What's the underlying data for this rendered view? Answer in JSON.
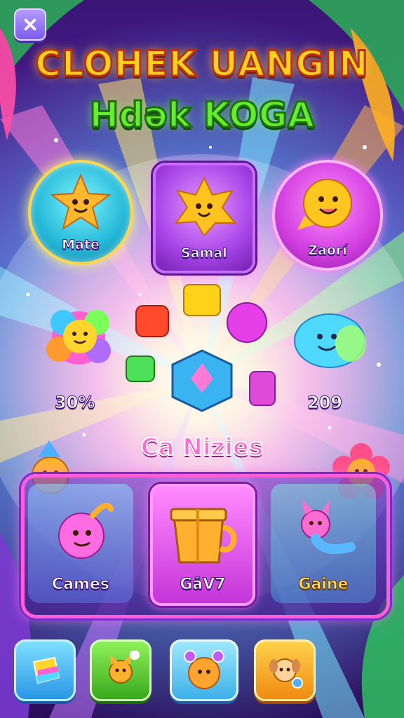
{
  "header": {
    "title_line1": "CLOHEK UANGIN",
    "title_line2": "Hdək KOGA"
  },
  "modes": [
    {
      "label": "Mate"
    },
    {
      "label": "Samal"
    },
    {
      "label": "Zaorí"
    }
  ],
  "stats": {
    "left_value": "30%",
    "right_value": "209"
  },
  "section_title": "Ca Nizies",
  "games": [
    {
      "label": "Cames"
    },
    {
      "label": "GāV7"
    },
    {
      "label": "Gaine"
    }
  ],
  "colors": {
    "title_yellow": "#ffd21a",
    "title_green": "#66ee2a",
    "accent_pink": "#ff5ed6",
    "accent_purple": "#a845e8",
    "accent_cyan": "#22b7d6"
  }
}
